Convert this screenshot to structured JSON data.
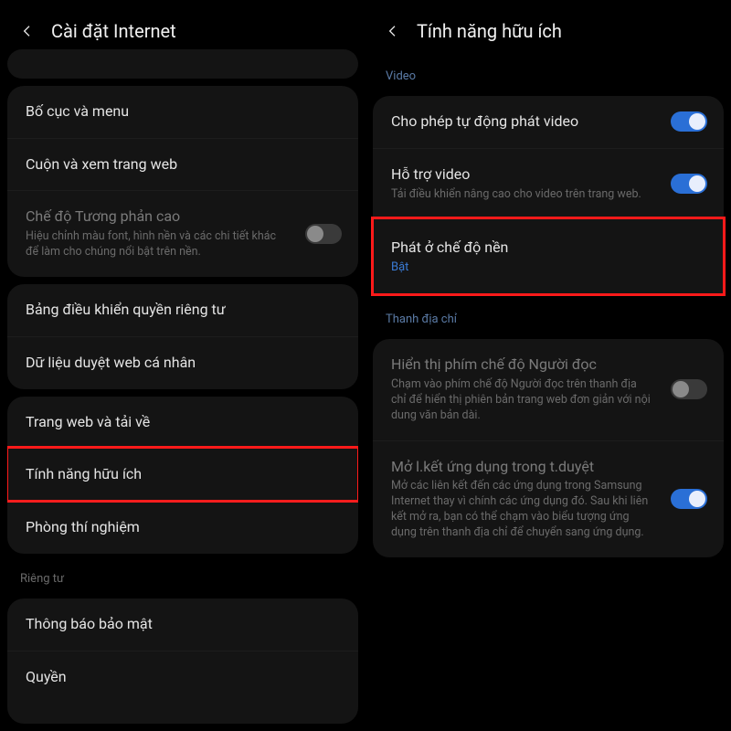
{
  "left": {
    "title": "Cài đặt Internet",
    "groups": [
      {
        "rows": [
          {
            "title": "Bố cục và menu"
          },
          {
            "title": "Cuộn và xem trang web"
          },
          {
            "title": "Chế độ Tương phản cao",
            "sub": "Hiệu chỉnh màu font, hình nền và các chi tiết khác để làm cho chúng nổi bật trên nền.",
            "toggle": "off",
            "dim": true
          }
        ]
      },
      {
        "rows": [
          {
            "title": "Bảng điều khiển quyền riêng tư"
          },
          {
            "title": "Dữ liệu duyệt web cá nhân"
          }
        ]
      },
      {
        "rows": [
          {
            "title": "Trang web và tải về"
          },
          {
            "title": "Tính năng hữu ích",
            "highlight": true
          },
          {
            "title": "Phòng thí nghiệm"
          }
        ]
      },
      {
        "section": "Riêng tư",
        "rows": [
          {
            "title": "Thông báo bảo mật"
          },
          {
            "title": "Quyền"
          }
        ]
      }
    ]
  },
  "right": {
    "title": "Tính năng hữu ích",
    "sections": [
      {
        "label": "Video",
        "rows": [
          {
            "title": "Cho phép tự động phát video",
            "toggle": "on"
          },
          {
            "title": "Hỗ trợ video",
            "sub": "Tải điều khiển nâng cao cho video trên trang web.",
            "toggle": "on"
          },
          {
            "title": "Phát ở chế độ nền",
            "status": "Bật",
            "highlight": true
          }
        ]
      },
      {
        "label": "Thanh địa chỉ",
        "rows": [
          {
            "title": "Hiển thị phím chế độ Người đọc",
            "sub": "Chạm vào phím chế độ Người đọc trên thanh địa chỉ để hiển thị phiên bản trang web đơn giản với nội dung văn bản dài.",
            "toggle": "off",
            "dim": true
          },
          {
            "title": "Mở l.kết ứng dụng trong t.duyệt",
            "sub": "Mở các liên kết đến các ứng dụng trong Samsung Internet thay vì chính các ứng dụng đó. Sau khi liên kết mở ra, bạn có thể chạm vào biểu tượng ứng dụng trên thanh địa chỉ để chuyển sang ứng dụng.",
            "toggle": "on",
            "dim": true
          }
        ]
      }
    ]
  }
}
